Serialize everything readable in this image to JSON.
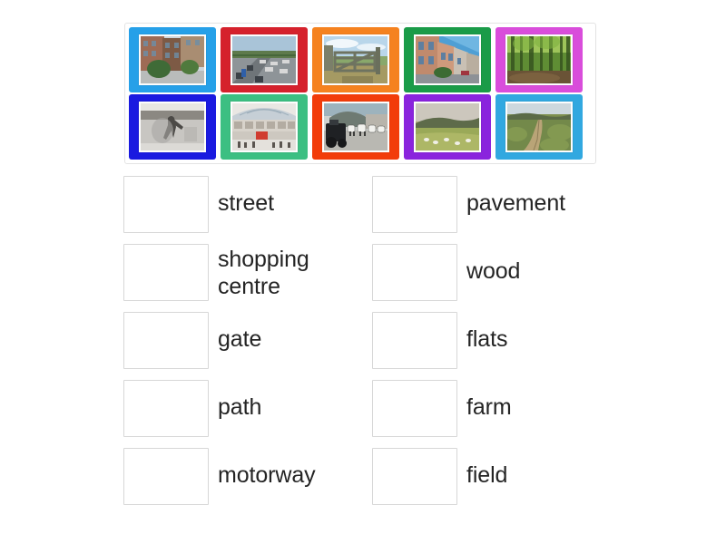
{
  "activity": {
    "type": "match-up-drag-and-drop",
    "tray": {
      "tiles": [
        {
          "id": "tile-flats",
          "alt": "flats",
          "border_color": "#26a0e8",
          "scene": "flats"
        },
        {
          "id": "tile-motorway",
          "alt": "motorway",
          "border_color": "#d5212c",
          "scene": "motorway"
        },
        {
          "id": "tile-gate",
          "alt": "gate",
          "border_color": "#f5821f",
          "scene": "gate"
        },
        {
          "id": "tile-street",
          "alt": "street",
          "border_color": "#1a9b48",
          "scene": "street"
        },
        {
          "id": "tile-wood",
          "alt": "wood",
          "border_color": "#d94ddb",
          "scene": "wood"
        },
        {
          "id": "tile-pavement",
          "alt": "pavement",
          "border_color": "#1a1ae0",
          "scene": "pavement"
        },
        {
          "id": "tile-shopping-centre",
          "alt": "shopping centre",
          "border_color": "#3cbf82",
          "scene": "shopping-centre"
        },
        {
          "id": "tile-farm",
          "alt": "farm",
          "border_color": "#f23c0a",
          "scene": "farm"
        },
        {
          "id": "tile-field",
          "alt": "field",
          "border_color": "#8a24dd",
          "scene": "field"
        },
        {
          "id": "tile-path",
          "alt": "path",
          "border_color": "#31a8e0",
          "scene": "path"
        }
      ]
    },
    "answers": {
      "left_column": [
        {
          "label": "street"
        },
        {
          "label": "shopping\ncentre"
        },
        {
          "label": "gate"
        },
        {
          "label": "path"
        },
        {
          "label": "motorway"
        }
      ],
      "right_column": [
        {
          "label": "pavement"
        },
        {
          "label": "wood"
        },
        {
          "label": "flats"
        },
        {
          "label": "farm"
        },
        {
          "label": "field"
        }
      ]
    },
    "colors": {
      "page_background": "#ffffff",
      "tray_border": "#e3e3e3",
      "drop_box_border": "#d7d7d7",
      "label_text": "#242424"
    }
  }
}
